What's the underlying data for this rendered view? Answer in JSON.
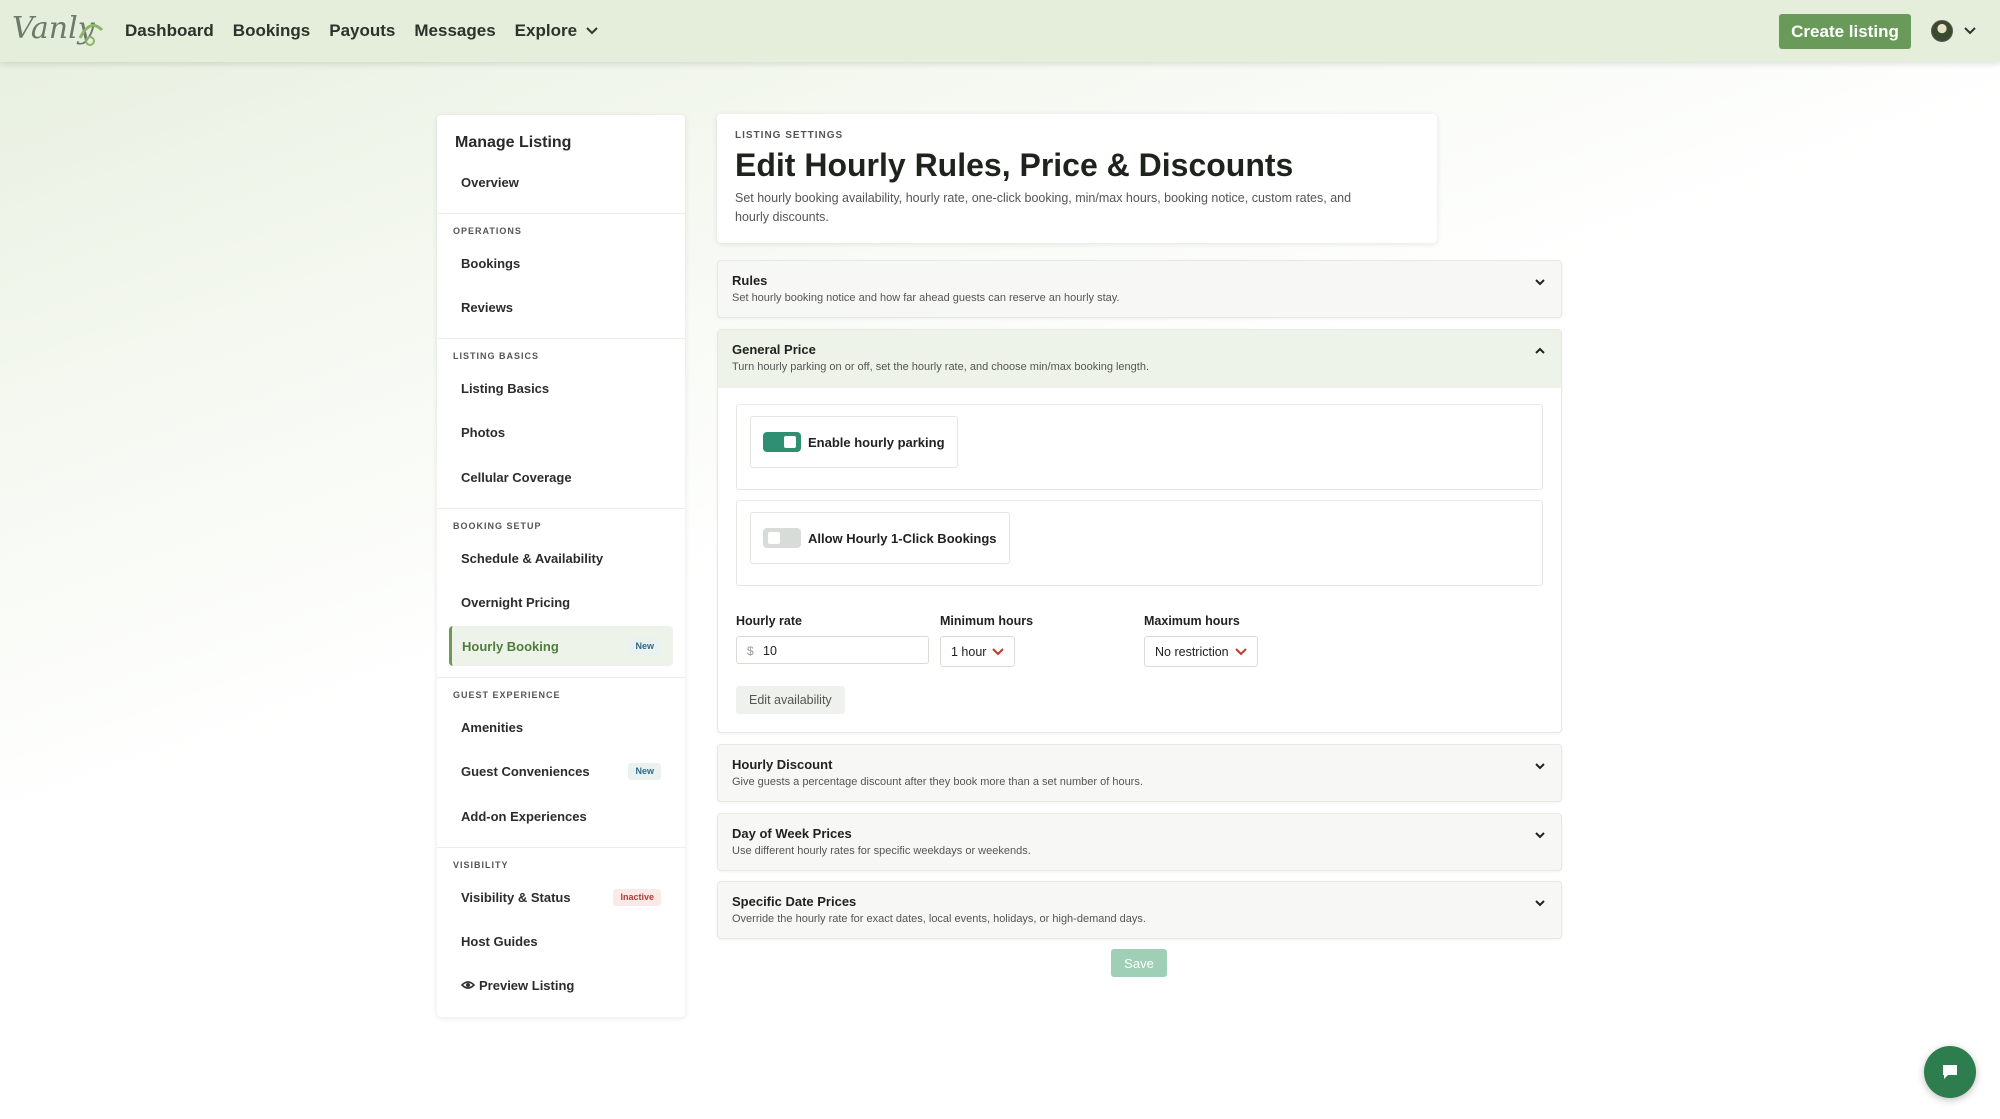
{
  "brand": {
    "logo_text": "Vanly",
    "accent": "#6a9a5a",
    "toggle_on": "#2e8f72"
  },
  "nav": {
    "items": [
      "Dashboard",
      "Bookings",
      "Payouts",
      "Messages"
    ],
    "explore_label": "Explore",
    "create_listing": "Create listing"
  },
  "sidebar": {
    "title": "Manage Listing",
    "overview": "Overview",
    "sections": {
      "operations": "OPERATIONS",
      "listing_basics": "LISTING BASICS",
      "booking_setup": "BOOKING SETUP",
      "guest_experience": "GUEST EXPERIENCE",
      "visibility": "VISIBILITY"
    },
    "items": {
      "bookings": "Bookings",
      "reviews": "Reviews",
      "listing_basics": "Listing Basics",
      "photos": "Photos",
      "cellular": "Cellular Coverage",
      "schedule": "Schedule & Availability",
      "overnight": "Overnight Pricing",
      "hourly": "Hourly Booking",
      "amenities": "Amenities",
      "conveniences": "Guest Conveniences",
      "addons": "Add-on Experiences",
      "visibility": "Visibility & Status",
      "guides": "Host Guides",
      "preview": "Preview Listing"
    },
    "badges": {
      "new": "New",
      "inactive": "Inactive"
    }
  },
  "header": {
    "eyebrow": "LISTING SETTINGS",
    "title": "Edit Hourly Rules, Price & Discounts",
    "description": "Set hourly booking availability, hourly rate, one-click booking, min/max hours, booking notice, custom rates, and hourly discounts."
  },
  "accordions": {
    "rules": {
      "title": "Rules",
      "subtitle": "Set hourly booking notice and how far ahead guests can reserve an hourly stay."
    },
    "general": {
      "title": "General Price",
      "subtitle": "Turn hourly parking on or off, set the hourly rate, and choose min/max booking length."
    },
    "discount": {
      "title": "Hourly Discount",
      "subtitle": "Give guests a percentage discount after they book more than a set number of hours."
    },
    "dow": {
      "title": "Day of Week Prices",
      "subtitle": "Use different hourly rates for specific weekdays or weekends."
    },
    "specific": {
      "title": "Specific Date Prices",
      "subtitle": "Override the hourly rate for exact dates, local events, holidays, or high-demand days."
    }
  },
  "general_price": {
    "enable_hourly": {
      "label": "Enable hourly parking",
      "on": true
    },
    "one_click": {
      "label": "Allow Hourly 1-Click Bookings",
      "on": false
    },
    "hourly_rate_label": "Hourly rate",
    "currency": "$",
    "hourly_rate_value": "10",
    "min_hours_label": "Minimum hours",
    "min_hours_value": "1 hour",
    "max_hours_label": "Maximum hours",
    "max_hours_value": "No restriction",
    "edit_availability": "Edit availability"
  },
  "save_label": "Save"
}
